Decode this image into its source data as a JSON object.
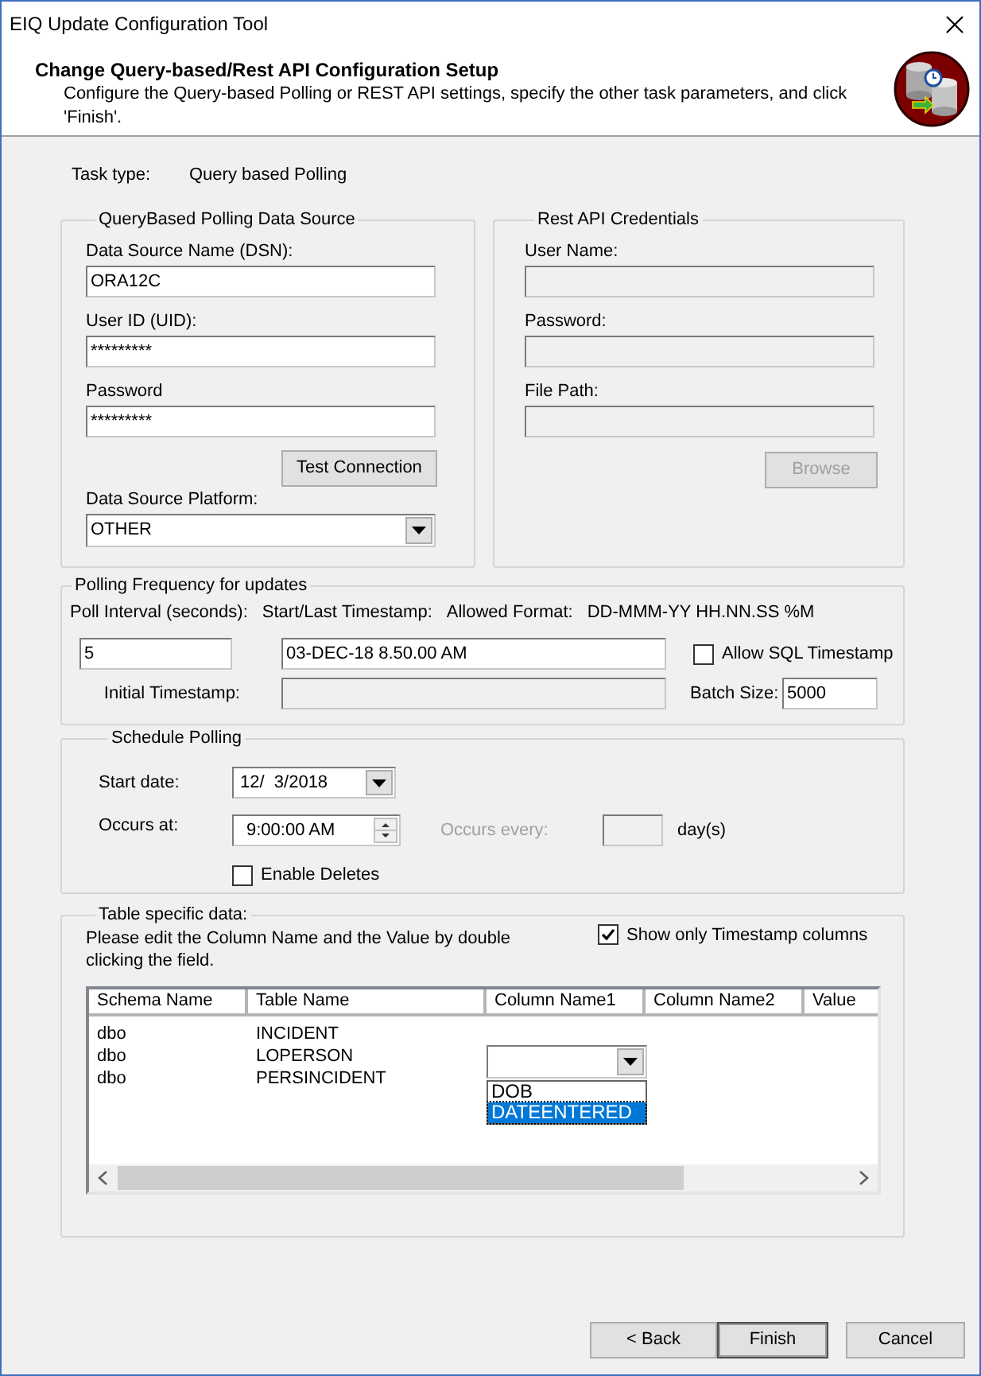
{
  "window": {
    "title": "EIQ Update Configuration Tool"
  },
  "header": {
    "title": "Change Query-based/Rest API Configuration Setup",
    "description": "Configure the Query-based Polling or REST API settings, specify the other task parameters, and click 'Finish'."
  },
  "task_type": {
    "label": "Task type:",
    "value": "Query based Polling"
  },
  "data_source": {
    "title": "QueryBased Polling Data Source",
    "fields": [
      {
        "label": "Data Source Name (DSN):",
        "value": "ORA12C",
        "disabled": false
      },
      {
        "label": "User ID (UID):",
        "value": "*********",
        "disabled": false
      },
      {
        "label": "Password",
        "value": "*********",
        "disabled": false
      }
    ],
    "test_button": "Test Connection",
    "platform": {
      "label": "Data Source Platform:",
      "value": "OTHER"
    }
  },
  "rest_api": {
    "title": "Rest API Credentials",
    "fields": [
      {
        "label": "User Name:",
        "disabled": true
      },
      {
        "label": "Password:",
        "disabled": true
      },
      {
        "label": "File Path:",
        "disabled": true
      }
    ],
    "browse_button": {
      "label": "Browse",
      "disabled": true
    }
  },
  "polling": {
    "title": "Polling Frequency for updates",
    "poll_interval_label": "Poll Interval (seconds):",
    "timestamp_label": "Start/Last Timestamp:",
    "format_label": "Allowed Format:",
    "format_value": "DD-MMM-YY HH.NN.SS %M",
    "poll_interval": "5",
    "timestamp": "03-DEC-18 8.50.00 AM",
    "allow_sql_timestamp": {
      "label": "Allow SQL Timestamp",
      "checked": false
    },
    "initial_timestamp": {
      "label": "Initial Timestamp:",
      "disabled": true
    },
    "batch_size": {
      "label": "Batch Size:",
      "value": "5000"
    }
  },
  "schedule": {
    "title": "Schedule Polling",
    "start_date": {
      "label": "Start date:",
      "value": "12/  3/2018"
    },
    "occurs_at": {
      "label": "Occurs at:",
      "value": "9:00:00 AM"
    },
    "occurs_every": {
      "label": "Occurs every:",
      "unit": "day(s)",
      "disabled": true
    },
    "enable_deletes": {
      "label": "Enable Deletes",
      "checked": false
    }
  },
  "table": {
    "title": "Table specific data:",
    "instructions": "Please edit the Column Name and the Value by double clicking the field.",
    "show_only_timestamp": {
      "label": "Show only Timestamp columns",
      "checked": true
    },
    "columns": [
      "Schema Name",
      "Table Name",
      "Column Name1",
      "Column Name2",
      "Value"
    ],
    "rows": [
      {
        "cells": [
          "dbo",
          "INCIDENT"
        ],
        "editing": false
      },
      {
        "cells": [
          "dbo",
          "LOPERSON"
        ],
        "editing": true
      },
      {
        "cells": [
          "dbo",
          "PERSINCIDENT"
        ],
        "editing": false
      }
    ],
    "editor_options": [
      {
        "label": "DOB",
        "selected": false
      },
      {
        "label": "DATEENTERED",
        "selected": true
      }
    ]
  },
  "buttons": [
    {
      "label": "< Back",
      "default": false
    },
    {
      "label": "Finish",
      "default": true
    },
    {
      "label": "Cancel",
      "default": false
    }
  ]
}
